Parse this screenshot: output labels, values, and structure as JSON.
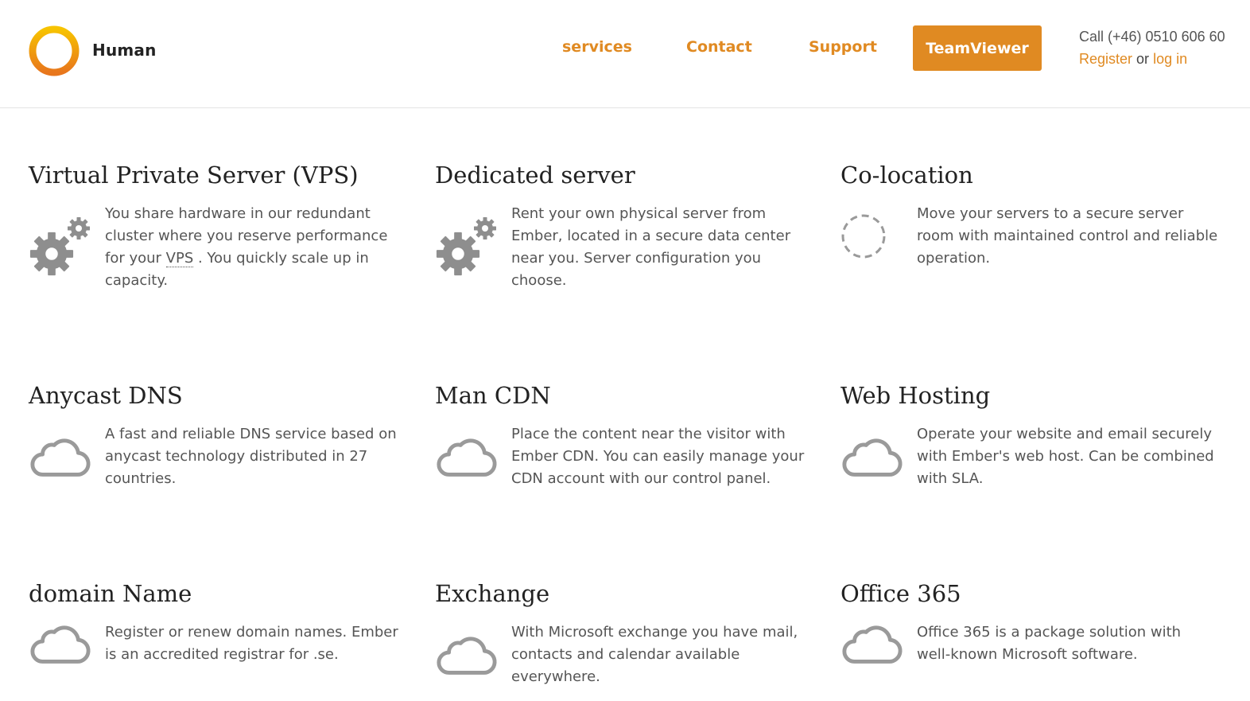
{
  "header": {
    "brand": "Human",
    "nav": [
      {
        "label": "services"
      },
      {
        "label": "Contact"
      },
      {
        "label": "Support"
      }
    ],
    "cta_label": "TeamViewer",
    "call_text": "Call (+46) 0510 606 60",
    "register_label": "Register",
    "or_text": "or",
    "login_label": "log in"
  },
  "colors": {
    "accent": "#e08a22",
    "heading": "#222222",
    "body_text": "#555555",
    "icon_gray": "#8e8e8e"
  },
  "services": [
    {
      "title": "Virtual Private Server (VPS)",
      "icon": "gears-icon",
      "text_before": "You share hardware in our redundant cluster where you reserve performance for your ",
      "abbr": "VPS",
      "text_after": " . You quickly scale up in capacity."
    },
    {
      "title": "Dedicated server",
      "icon": "gears-icon",
      "text": "Rent your own physical server from Ember, located in a secure data center near you. Server configuration you choose."
    },
    {
      "title": "Co-location",
      "icon": "dashed-circle-icon",
      "text": "Move your servers to a secure server room with maintained control and reliable operation."
    },
    {
      "title": "Anycast DNS",
      "icon": "cloud-icon",
      "text": "A fast and reliable DNS service based on anycast technology distributed in 27 countries."
    },
    {
      "title": "Man CDN",
      "icon": "cloud-icon",
      "text": "Place the content near the visitor with Ember CDN. You can easily manage your CDN account with our control panel."
    },
    {
      "title": "Web Hosting",
      "icon": "cloud-icon",
      "text": "Operate your website and email securely with Ember's web host. Can be combined with SLA."
    },
    {
      "title": "domain Name",
      "icon": "cloud-icon",
      "text": "Register or renew domain names. Ember is an accredited registrar for .se."
    },
    {
      "title": "Exchange",
      "icon": "cloud-icon",
      "text": "With Microsoft exchange you have mail, contacts and calendar available everywhere."
    },
    {
      "title": "Office 365",
      "icon": "cloud-icon",
      "text": "Office 365 is a package solution with well-known Microsoft software."
    }
  ]
}
